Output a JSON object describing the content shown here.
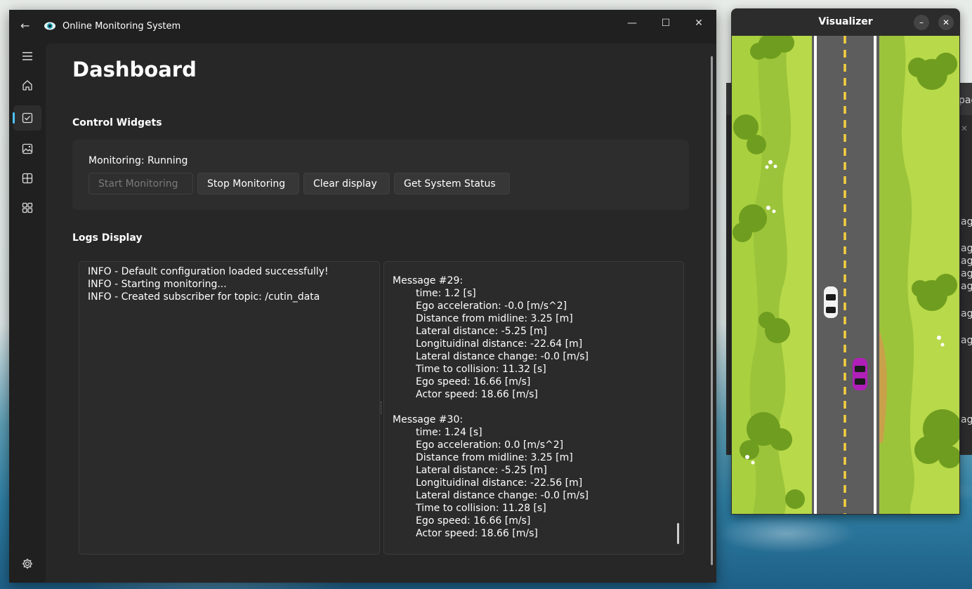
{
  "app": {
    "title": "Online Monitoring System"
  },
  "titlebar_controls": {
    "minimize": "—",
    "maximize": "☐",
    "close": "✕"
  },
  "sidebar": {
    "items": [
      {
        "icon": "hamburger-menu-icon"
      },
      {
        "icon": "home-icon"
      },
      {
        "icon": "checkbox-icon",
        "active": true
      },
      {
        "icon": "image-icon"
      },
      {
        "icon": "table-icon"
      },
      {
        "icon": "widgets-icon"
      }
    ],
    "footer_icon": "gear-icon"
  },
  "page": {
    "title": "Dashboard"
  },
  "control_widgets": {
    "heading": "Control Widgets",
    "status": "Monitoring: Running",
    "buttons": {
      "start": "Start Monitoring",
      "stop": "Stop Monitoring",
      "clear": "Clear display",
      "status": "Get System Status"
    }
  },
  "logs": {
    "heading": "Logs Display",
    "lines": [
      "INFO - Default configuration loaded successfully!",
      "INFO - Starting monitoring...",
      "INFO - Created subscriber for topic: /cutin_data"
    ],
    "messages": [
      {
        "header": "Message #29:",
        "fields": [
          "time: 1.2 [s]",
          "Ego acceleration: -0.0 [m/s^2]",
          "Distance from midline: 3.25 [m]",
          "Lateral distance: -5.25 [m]",
          "Longituidinal distance: -22.64 [m]",
          "Lateral distance change: -0.0 [m/s]",
          "Time to collision: 11.32 [s]",
          "Ego speed: 16.66 [m/s]",
          "Actor speed: 18.66 [m/s]"
        ]
      },
      {
        "header": "Message #30:",
        "fields": [
          "time: 1.24 [s]",
          "Ego acceleration: 0.0 [m/s^2]",
          "Distance from midline: 3.25 [m]",
          "Lateral distance: -5.25 [m]",
          "Longituidinal distance: -22.56 [m]",
          "Lateral distance change: -0.0 [m/s]",
          "Time to collision: 11.28 [s]",
          "Ego speed: 16.66 [m/s]",
          "Actor speed: 18.66 [m/s]"
        ]
      }
    ]
  },
  "visualizer": {
    "title": "Visualizer",
    "minimize": "–",
    "close": "✕",
    "cars": [
      {
        "name": "ego",
        "color": "#f2f2f2"
      },
      {
        "name": "actor",
        "color": "#b01fb8"
      }
    ]
  },
  "background_terminal": {
    "tab_fragment": "pac",
    "line_fragments": [
      "ag",
      "ag",
      "ag",
      "ag",
      "ag",
      "ag",
      "ag",
      "ag"
    ]
  },
  "colors": {
    "accent": "#4cc2ff",
    "road": "#5d5d5d",
    "grass": "#b7d94a",
    "lane_yellow": "#f4d03f"
  }
}
